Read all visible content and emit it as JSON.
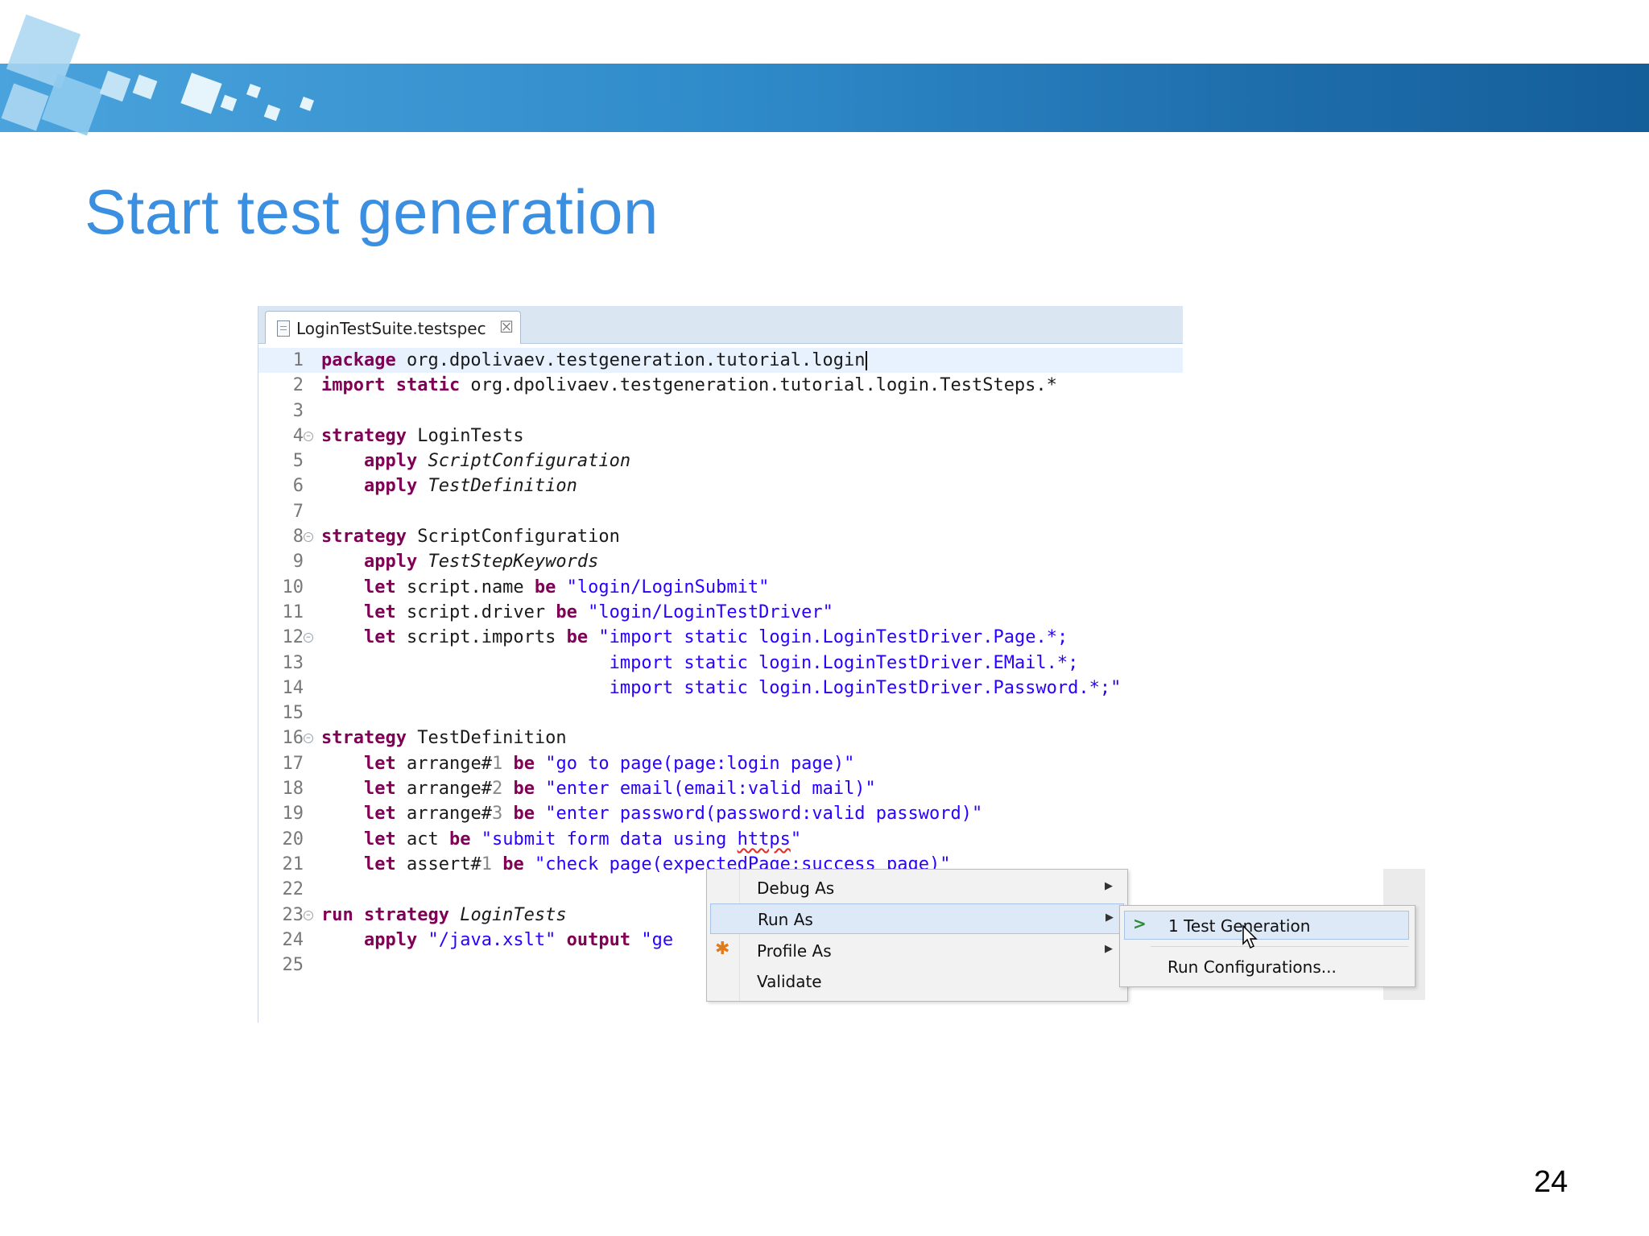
{
  "slide": {
    "title": "Start test generation",
    "page_number": "24",
    "colors": {
      "banner": "#2f8ac9",
      "title": "#3b8fe0"
    }
  },
  "editor": {
    "tab": {
      "label": "LoginTestSuite.testspec",
      "icon": "document-icon",
      "close_icon": "close-icon"
    },
    "line_numbers": [
      "1",
      "2",
      "3",
      "4",
      "5",
      "6",
      "7",
      "8",
      "9",
      "10",
      "11",
      "12",
      "13",
      "14",
      "15",
      "16",
      "17",
      "18",
      "19",
      "20",
      "21",
      "22",
      "23",
      "24",
      "25"
    ],
    "lines": [
      [
        {
          "t": "package",
          "k": "kw"
        },
        {
          "t": " org.dpolivaev.testgeneration.tutorial.login"
        }
      ],
      [
        {
          "t": "import static",
          "k": "kw"
        },
        {
          "t": " org.dpolivaev.testgeneration.tutorial.login.TestSteps.*"
        }
      ],
      [],
      [
        {
          "t": "strategy",
          "k": "kw"
        },
        {
          "t": " LoginTests"
        }
      ],
      [
        {
          "t": "    "
        },
        {
          "t": "apply",
          "k": "kw"
        },
        {
          "t": " "
        },
        {
          "t": "ScriptConfiguration",
          "k": "it"
        }
      ],
      [
        {
          "t": "    "
        },
        {
          "t": "apply",
          "k": "kw"
        },
        {
          "t": " "
        },
        {
          "t": "TestDefinition",
          "k": "it"
        }
      ],
      [],
      [
        {
          "t": "strategy",
          "k": "kw"
        },
        {
          "t": " ScriptConfiguration"
        }
      ],
      [
        {
          "t": "    "
        },
        {
          "t": "apply",
          "k": "kw"
        },
        {
          "t": " "
        },
        {
          "t": "TestStepKeywords",
          "k": "it"
        }
      ],
      [
        {
          "t": "    "
        },
        {
          "t": "let",
          "k": "kw"
        },
        {
          "t": " script.name "
        },
        {
          "t": "be",
          "k": "kw"
        },
        {
          "t": " "
        },
        {
          "t": "\"login/LoginSubmit\"",
          "k": "str"
        }
      ],
      [
        {
          "t": "    "
        },
        {
          "t": "let",
          "k": "kw"
        },
        {
          "t": " script.driver "
        },
        {
          "t": "be",
          "k": "kw"
        },
        {
          "t": " "
        },
        {
          "t": "\"login/LoginTestDriver\"",
          "k": "str"
        }
      ],
      [
        {
          "t": "    "
        },
        {
          "t": "let",
          "k": "kw"
        },
        {
          "t": " script.imports "
        },
        {
          "t": "be",
          "k": "kw"
        },
        {
          "t": " "
        },
        {
          "t": "\"import static login.LoginTestDriver.Page.*;",
          "k": "str"
        }
      ],
      [
        {
          "t": "                           "
        },
        {
          "t": "import static login.LoginTestDriver.EMail.*;",
          "k": "str"
        }
      ],
      [
        {
          "t": "                           "
        },
        {
          "t": "import static login.LoginTestDriver.Password.*;\"",
          "k": "str"
        }
      ],
      [],
      [
        {
          "t": "strategy",
          "k": "kw"
        },
        {
          "t": " TestDefinition"
        }
      ],
      [
        {
          "t": "    "
        },
        {
          "t": "let",
          "k": "kw"
        },
        {
          "t": " arrange#"
        },
        {
          "t": "1",
          "k": "dim"
        },
        {
          "t": " "
        },
        {
          "t": "be",
          "k": "kw"
        },
        {
          "t": " "
        },
        {
          "t": "\"go to page(page:login page)\"",
          "k": "str"
        }
      ],
      [
        {
          "t": "    "
        },
        {
          "t": "let",
          "k": "kw"
        },
        {
          "t": " arrange#"
        },
        {
          "t": "2",
          "k": "dim"
        },
        {
          "t": " "
        },
        {
          "t": "be",
          "k": "kw"
        },
        {
          "t": " "
        },
        {
          "t": "\"enter email(email:valid mail)\"",
          "k": "str"
        }
      ],
      [
        {
          "t": "    "
        },
        {
          "t": "let",
          "k": "kw"
        },
        {
          "t": " arrange#"
        },
        {
          "t": "3",
          "k": "dim"
        },
        {
          "t": " "
        },
        {
          "t": "be",
          "k": "kw"
        },
        {
          "t": " "
        },
        {
          "t": "\"enter password(password:valid password)\"",
          "k": "str"
        }
      ],
      [
        {
          "t": "    "
        },
        {
          "t": "let",
          "k": "kw"
        },
        {
          "t": " act "
        },
        {
          "t": "be",
          "k": "kw"
        },
        {
          "t": " "
        },
        {
          "t": "\"submit form data using ",
          "k": "str"
        },
        {
          "t": "https",
          "k": "str squiggle"
        },
        {
          "t": "\"",
          "k": "str"
        }
      ],
      [
        {
          "t": "    "
        },
        {
          "t": "let",
          "k": "kw"
        },
        {
          "t": " assert#"
        },
        {
          "t": "1",
          "k": "dim"
        },
        {
          "t": " "
        },
        {
          "t": "be",
          "k": "kw"
        },
        {
          "t": " "
        },
        {
          "t": "\"check page(expectedPage:success page)\"",
          "k": "str"
        }
      ],
      [],
      [
        {
          "t": "run strategy",
          "k": "kw"
        },
        {
          "t": " "
        },
        {
          "t": "LoginTests",
          "k": "it"
        }
      ],
      [
        {
          "t": "    "
        },
        {
          "t": "apply",
          "k": "kw"
        },
        {
          "t": " "
        },
        {
          "t": "\"/java.xslt\"",
          "k": "str"
        },
        {
          "t": " "
        },
        {
          "t": "output",
          "k": "kw"
        },
        {
          "t": " "
        },
        {
          "t": "\"ge",
          "k": "str"
        }
      ],
      []
    ],
    "fold_markers_on_lines": [
      "4",
      "8",
      "12",
      "16",
      "23"
    ]
  },
  "context_menu": {
    "items": [
      {
        "label": "Debug As",
        "has_submenu": true
      },
      {
        "label": "Run As",
        "has_submenu": true,
        "highlighted": true
      },
      {
        "label": "Profile As",
        "has_submenu": true,
        "icon": "profile-icon"
      },
      {
        "label": "Validate",
        "has_submenu": false
      }
    ]
  },
  "submenu": {
    "items": [
      {
        "label": "1 Test Generation",
        "icon": "run-icon",
        "highlighted": true
      },
      {
        "label": "Run Configurations..."
      }
    ]
  }
}
